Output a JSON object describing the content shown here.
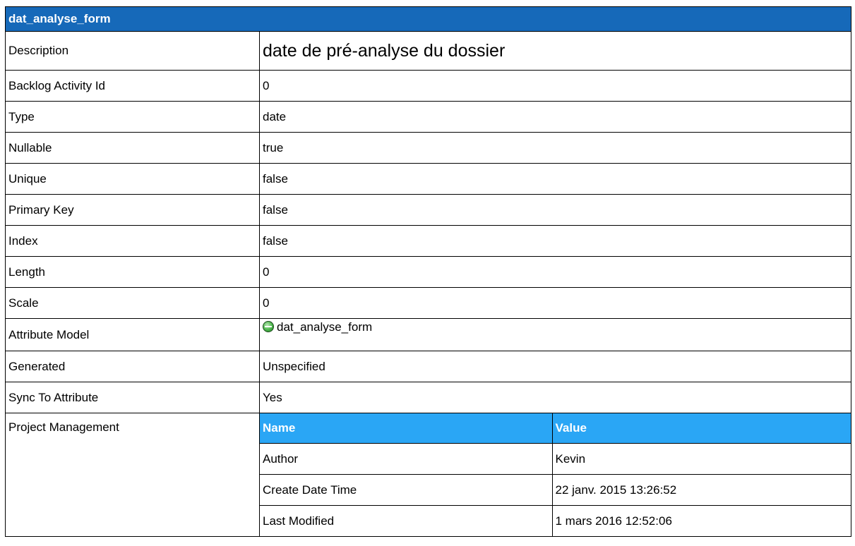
{
  "title": "dat_analyse_form",
  "rows": [
    {
      "label": "Description",
      "value": "date de pré-analyse du dossier"
    },
    {
      "label": "Backlog Activity Id",
      "value": "0"
    },
    {
      "label": "Type",
      "value": "date"
    },
    {
      "label": "Nullable",
      "value": "true"
    },
    {
      "label": "Unique",
      "value": "false"
    },
    {
      "label": "Primary Key",
      "value": "false"
    },
    {
      "label": "Index",
      "value": "false"
    },
    {
      "label": "Length",
      "value": "0"
    },
    {
      "label": "Scale",
      "value": "0"
    },
    {
      "label": "Attribute Model",
      "value": "dat_analyse_form",
      "icon": "attribute-model-icon"
    },
    {
      "label": "Generated",
      "value": "Unspecified"
    },
    {
      "label": "Sync To Attribute",
      "value": "Yes"
    }
  ],
  "project_management": {
    "label": "Project Management",
    "columns": [
      "Name",
      "Value"
    ],
    "rows": [
      {
        "name": "Author",
        "value": "Kevin"
      },
      {
        "name": "Create Date Time",
        "value": "22 janv. 2015 13:26:52"
      },
      {
        "name": "Last Modified",
        "value": "1 mars 2016 12:52:06"
      }
    ]
  },
  "colors": {
    "title_bar": "#1669b9",
    "subtable_header": "#2aa6f5"
  }
}
